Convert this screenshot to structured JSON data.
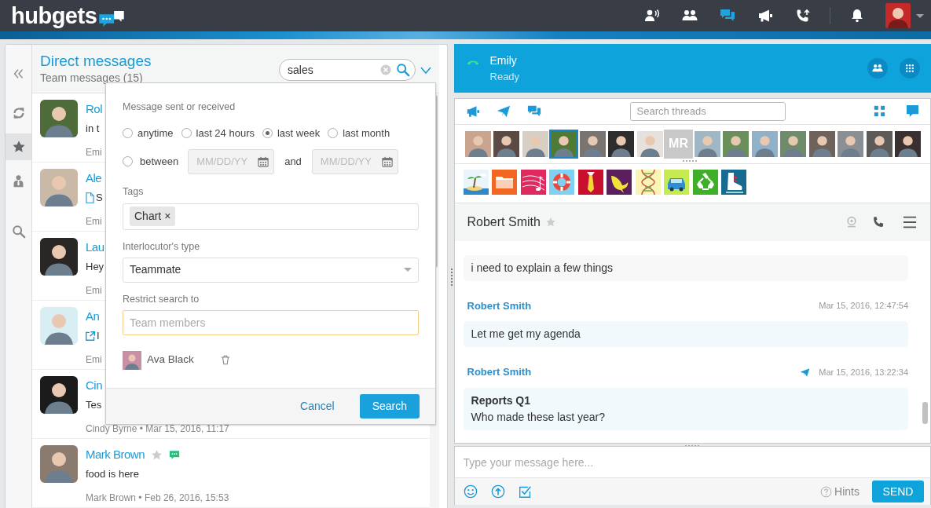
{
  "top_bar": {
    "logo": "hubgets",
    "nav_icons": [
      {
        "selected": false
      },
      {
        "selected": false
      },
      {
        "selected": true
      },
      {
        "selected": false
      },
      {
        "selected": false
      },
      {
        "selected": false
      }
    ]
  },
  "sidebar": {
    "items": [
      {
        "selected": false
      },
      {
        "selected": false
      },
      {
        "selected": true
      },
      {
        "selected": false
      },
      {
        "selected": false
      }
    ]
  },
  "list_header": {
    "title": "Direct messages",
    "subtitle": "Team messages (15)",
    "search": {
      "value": "sales"
    }
  },
  "conversations": [
    {
      "name": "Rol",
      "kind": "text",
      "text": "in t",
      "meta": "Emi"
    },
    {
      "name": "Ale",
      "kind": "file",
      "text": "S",
      "meta": "Emi"
    },
    {
      "name": "Lau",
      "kind": "text",
      "text": "Hey",
      "meta": "Emi"
    },
    {
      "name": "An",
      "kind": "link",
      "text": "I",
      "meta": "Emi"
    },
    {
      "name": "Cin",
      "kind": "text",
      "text": "Tes",
      "meta": "Cindy Byrne • Mar 15, 2016, 11:17"
    },
    {
      "name": "Mark Brown",
      "kind": "text",
      "text": "food is here",
      "meta": "Mark Brown • Feb 26, 2016, 15:53",
      "starred": false,
      "chat_badge": true
    }
  ],
  "search_popup": {
    "section_label": "Message sent or received",
    "periods": [
      {
        "label": "anytime",
        "selected": false
      },
      {
        "label": "last 24 hours",
        "selected": false
      },
      {
        "label": "last week",
        "selected": true
      },
      {
        "label": "last month",
        "selected": false
      }
    ],
    "between": {
      "label": "between",
      "selected": false,
      "from_placeholder": "MM/DD/YY",
      "and": "and",
      "to_placeholder": "MM/DD/YY"
    },
    "tags_label": "Tags",
    "tags": [
      {
        "label": "Chart",
        "remove": "×"
      }
    ],
    "type_label": "Interlocutor's type",
    "type_value": "Teammate",
    "restrict_label": "Restrict search to",
    "restrict_placeholder": "Team members",
    "members": [
      {
        "name": "Ava Black"
      }
    ],
    "cancel": "Cancel",
    "search": "Search"
  },
  "call_panel": {
    "name": "Emily",
    "status": "Ready"
  },
  "threads": {
    "search_placeholder": "Search threads",
    "avatars": [
      {
        "selected": false
      },
      {
        "selected": false
      },
      {
        "selected": false
      },
      {
        "selected": true
      },
      {
        "selected": false
      },
      {
        "selected": false
      },
      {
        "selected": false
      },
      {
        "selected": false,
        "initials": "MR"
      },
      {
        "selected": false
      },
      {
        "selected": false
      },
      {
        "selected": false
      },
      {
        "selected": false
      },
      {
        "selected": false
      },
      {
        "selected": false
      },
      {
        "selected": false
      },
      {
        "selected": false
      }
    ]
  },
  "chat": {
    "title": "Robert Smith",
    "starred": false,
    "messages": [
      {
        "text": "i need to explain a few things"
      },
      {
        "sender": "Robert Smith",
        "time": "Mar 15, 2016, 12:47:54",
        "sent": false,
        "text": "Let me get my agenda"
      },
      {
        "sender": "Robert Smith",
        "time": "Mar 15, 2016, 13:22:34",
        "sent": true,
        "title": "Reports Q1",
        "text": "Who made these last year?"
      }
    ]
  },
  "composer": {
    "placeholder": "Type your message here...",
    "hints": "Hints",
    "send": "SEND"
  }
}
